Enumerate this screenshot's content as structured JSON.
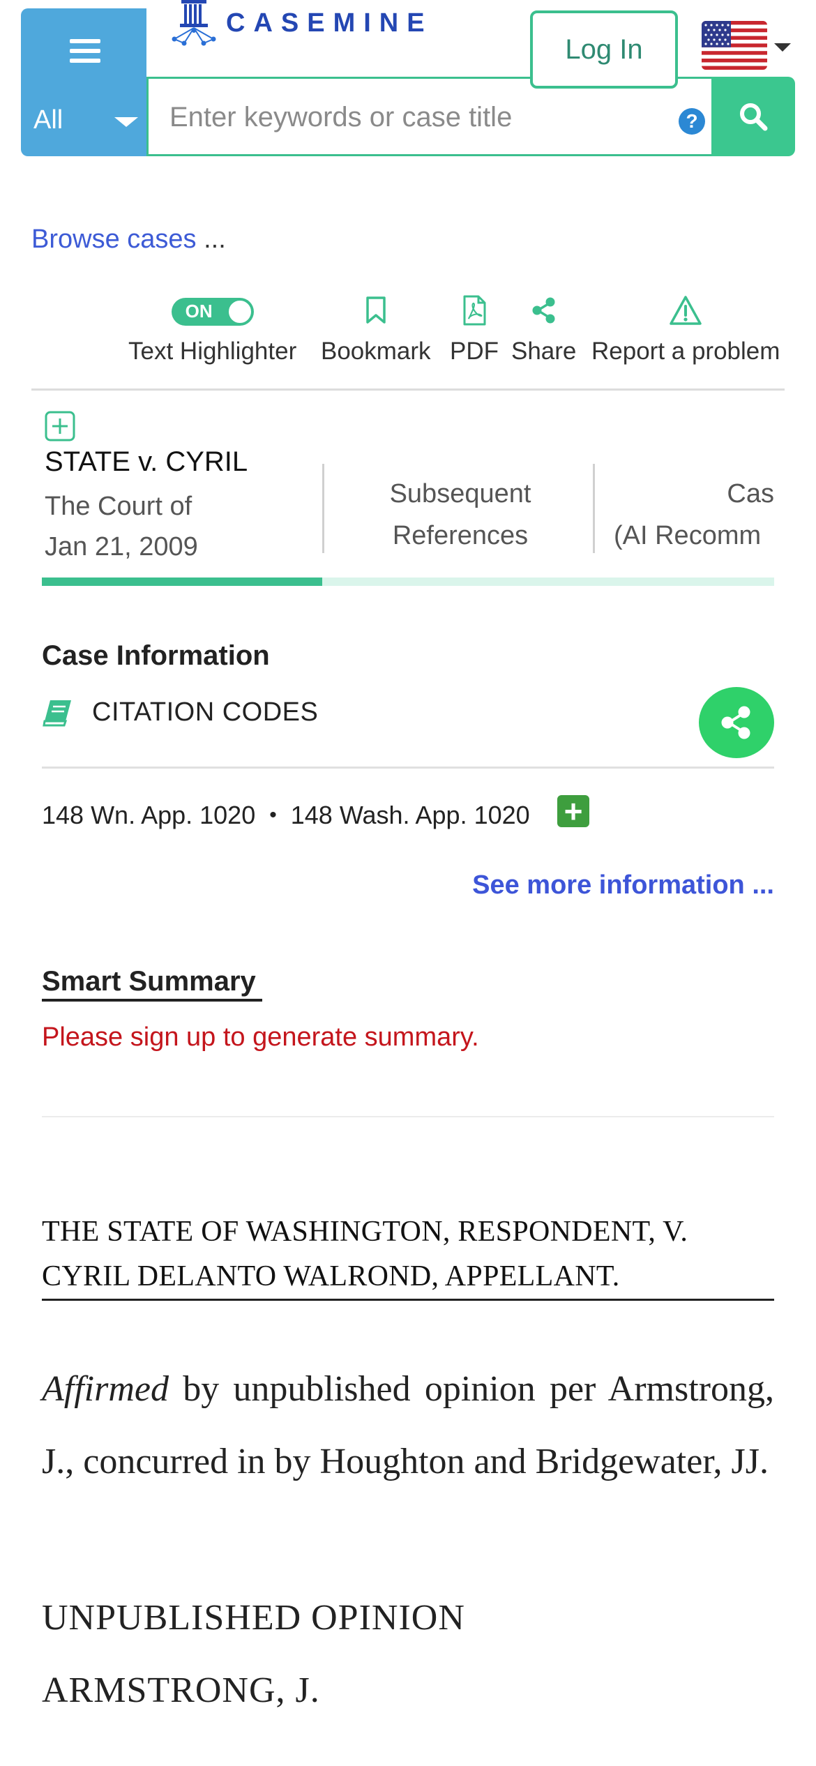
{
  "header": {
    "logo_text": "CASEMINE",
    "login_label": "Log In",
    "category_selected": "All",
    "search_placeholder": "Enter keywords or case title",
    "help_label": "?"
  },
  "breadcrumb": {
    "browse_label": "Browse cases",
    "ellipsis": "..."
  },
  "toolbar": {
    "toggle_state": "ON",
    "highlighter_label": "Text Highlighter",
    "bookmark_label": "Bookmark",
    "pdf_label": "PDF",
    "share_label": "Share",
    "report_label": "Report a problem"
  },
  "tabs": {
    "case_title": "STATE v. CYRIL",
    "court": "The Court of",
    "date": "Jan 21, 2009",
    "subsequent_line1": "Subsequent",
    "subsequent_line2": "References",
    "ai_line1": "Cas",
    "ai_line2": "(AI Recomm"
  },
  "case_info": {
    "heading": "Case Information",
    "citation_codes_label": "CITATION CODES",
    "citations": [
      "148 Wn. App. 1020",
      "148 Wash. App. 1020"
    ],
    "separator": "•",
    "see_more": "See more information ..."
  },
  "smart_summary": {
    "heading": "Smart Summary",
    "message": "Please sign up to generate summary."
  },
  "document": {
    "caption": "THE STATE OF WASHINGTON, RESPONDENT, V. CYRIL DELANTO WALROND, APPELLANT.",
    "affirmed_word": "Affirmed",
    "affirmed_rest": "by unpublished opinion per Armstrong, J., concurred in by Houghton and Bridgewater, JJ.",
    "heading1": "UNPUBLISHED OPINION",
    "heading2": "ARMSTRONG, J."
  },
  "colors": {
    "brand_blue": "#4fa8dc",
    "accent_green": "#3bbf8e",
    "share_green": "#2fd16a",
    "link_blue": "#3d55d8",
    "error_red": "#c4151c"
  }
}
